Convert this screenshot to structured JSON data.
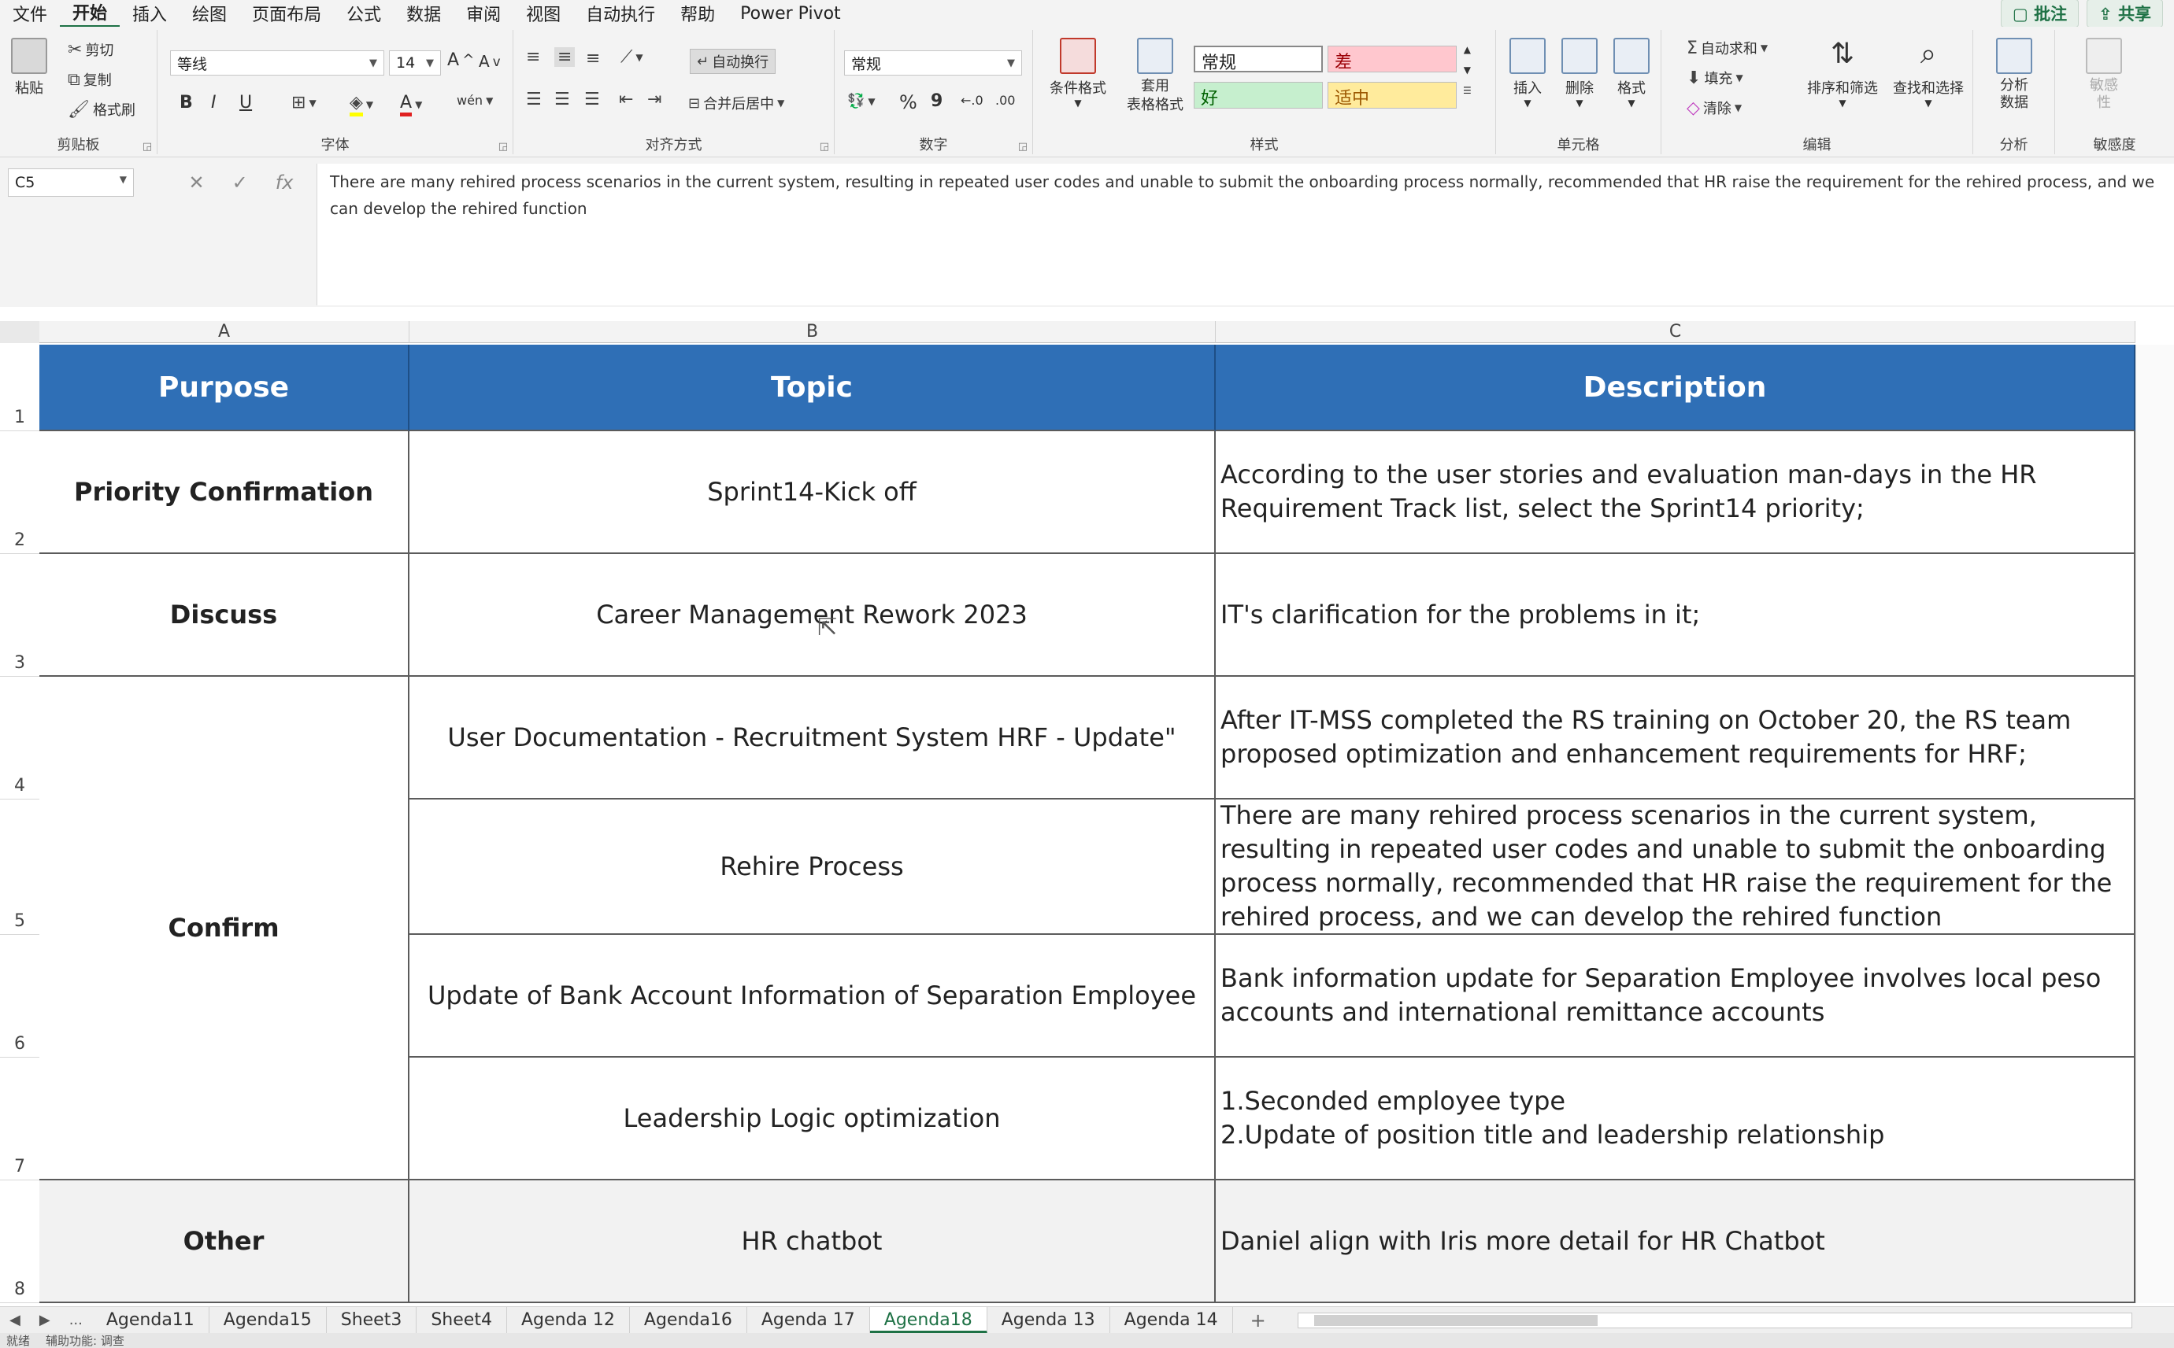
{
  "menu": {
    "items": [
      "文件",
      "开始",
      "插入",
      "绘图",
      "页面布局",
      "公式",
      "数据",
      "审阅",
      "视图",
      "自动执行",
      "帮助",
      "Power Pivot"
    ],
    "active": "开始",
    "comments": "批注",
    "share": "共享"
  },
  "ribbon": {
    "clipboard": {
      "paste": "粘贴",
      "cut": "剪切",
      "copy": "复制",
      "format_painter": "格式刷",
      "label": "剪贴板"
    },
    "font": {
      "name": "等线",
      "size": "14",
      "bold": "B",
      "italic": "I",
      "underline": "U",
      "grow": "A",
      "shrink": "A",
      "phonetic": "wén",
      "label": "字体"
    },
    "alignment": {
      "wrap": "自动换行",
      "merge": "合并后居中",
      "label": "对齐方式"
    },
    "number": {
      "format": "常规",
      "percent": "%",
      "comma": "9",
      "label": "数字"
    },
    "styles": {
      "conditional": "条件格式",
      "table": "套用\n表格格式",
      "normal": "常规",
      "bad": "差",
      "good": "好",
      "neutral": "适中",
      "label": "样式"
    },
    "cells": {
      "insert": "插入",
      "delete": "删除",
      "format": "格式",
      "label": "单元格"
    },
    "editing": {
      "autosum": "自动求和",
      "fill": "填充",
      "clear": "清除",
      "sort": "排序和筛选",
      "find": "查找和选择",
      "label": "编辑"
    },
    "analysis": {
      "analyze": "分析\n数据",
      "label": "分析"
    },
    "sensitivity": {
      "btn": "敏感\n性",
      "label": "敏感度"
    }
  },
  "formula_bar": {
    "name_box": "C5",
    "cancel": "✕",
    "enter": "✓",
    "fx": "fx",
    "content": "There are many rehired process scenarios in the current system, resulting in repeated user codes and unable to submit the onboarding process normally, recommended that HR raise the requirement for the rehired process, and we can develop the rehired function"
  },
  "grid": {
    "columns": [
      "A",
      "B",
      "C"
    ],
    "rows": [
      "1",
      "2",
      "3",
      "4",
      "5",
      "6",
      "7",
      "8"
    ],
    "header": {
      "purpose": "Purpose",
      "topic": "Topic",
      "description": "Description"
    },
    "r2": {
      "purpose": "Priority Confirmation",
      "topic": "Sprint14-Kick off",
      "description": "According to the user stories and evaluation man-days in the HR Requirement Track list, select the Sprint14 priority;"
    },
    "r3": {
      "purpose": "Discuss",
      "topic": "Career Management Rework 2023",
      "description": "IT's clarification for the problems in it;"
    },
    "confirm": "Confirm",
    "r4": {
      "topic": "User Documentation - Recruitment System HRF - Update\"",
      "description": "After IT-MSS completed the RS training on October 20, the RS team proposed optimization and enhancement requirements for HRF;"
    },
    "r5": {
      "topic": "Rehire Process",
      "description": "There are many rehired process scenarios in the current system, resulting in repeated user codes and unable to submit the onboarding process normally, recommended that HR raise the requirement for the rehired process, and we can develop the rehired function"
    },
    "r6": {
      "topic": "Update of Bank Account Information of Separation Employee",
      "description": "Bank information update for Separation Employee involves local peso accounts and international remittance accounts"
    },
    "r7": {
      "topic": "Leadership Logic optimization",
      "description_line1": "1.Seconded employee type",
      "description_line2": "2.Update of position title and leadership relationship"
    },
    "r8": {
      "purpose": "Other",
      "topic": "HR chatbot",
      "description": "Daniel align with Iris more detail for HR Chatbot"
    }
  },
  "sheet_tabs": {
    "more": "...",
    "tabs": [
      "Agenda11",
      "Agenda15",
      "Sheet3",
      "Sheet4",
      "Agenda 12",
      "Agenda16",
      "Agenda 17",
      "Agenda18",
      "Agenda 13",
      "Agenda 14"
    ],
    "active": "Agenda18",
    "add": "+"
  },
  "status": {
    "ready": "就绪",
    "accessibility": "辅助功能: 调查"
  },
  "colors": {
    "header_bg": "#2f6fb6",
    "accent": "#1e7145",
    "bad_bg": "#ffc7ce",
    "good_bg": "#c6efce",
    "neutral_bg": "#ffeb9c"
  }
}
